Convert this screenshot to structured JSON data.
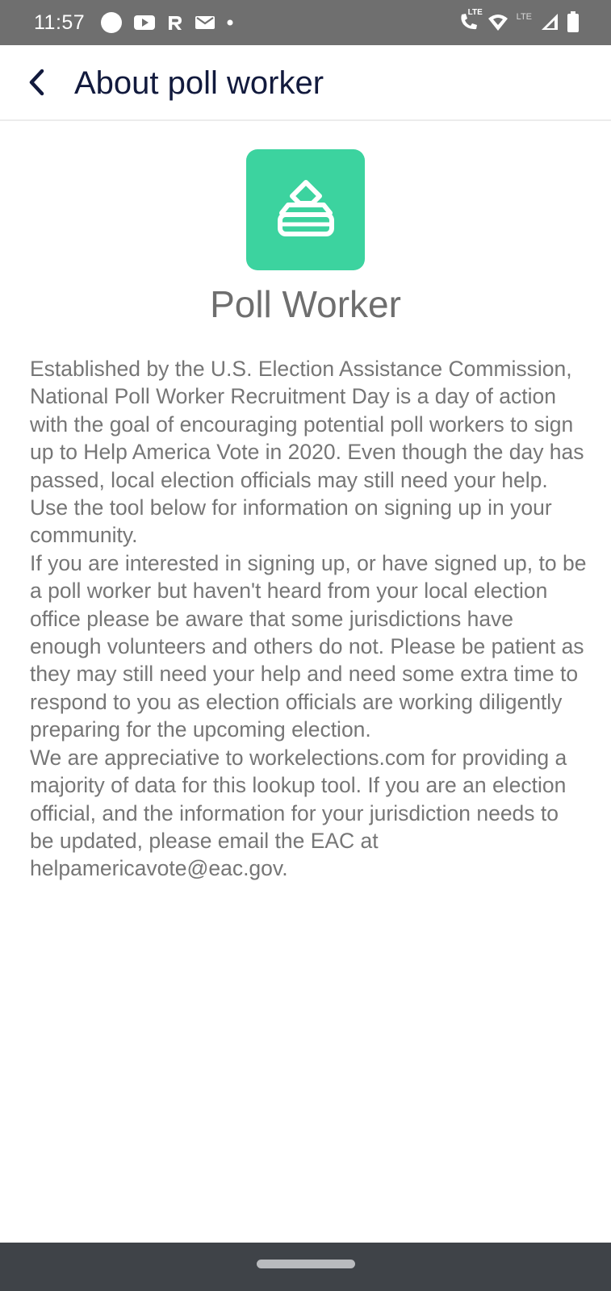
{
  "status_bar": {
    "time": "11:57",
    "left_icons": [
      "circle-icon",
      "youtube-icon",
      "r-app-icon",
      "mail-icon",
      "dot-icon"
    ],
    "right_icons": [
      "lte-call-icon",
      "wifi-icon",
      "signal-icon",
      "battery-icon"
    ],
    "lte_label": "LTE",
    "call_lte_label": "LTE"
  },
  "app_bar": {
    "back_icon": "chevron-left-icon",
    "title": "About poll worker"
  },
  "logo": {
    "icon": "ballot-box-icon",
    "color": "#3cd39f"
  },
  "content": {
    "heading": "Poll Worker",
    "paragraphs": [
      "Established by the U.S. Election Assistance Commission, National Poll Worker Recruitment Day is a day of action with the goal of encouraging potential poll workers to sign up to Help America Vote in 2020. Even though the day has passed, local election officials may still need your help. Use the tool below for information on signing up in your community.",
      "If you are interested in signing up, or have signed up, to be a poll worker but haven't heard from your local election office please be aware that some jurisdictions have enough volunteers and others do not. Please be patient as they may still need your help and need some extra time to respond to you as election officials are working diligently preparing for the upcoming election.",
      "We are appreciative to workelections.com for providing a majority of data for this lookup tool. If you are an election official, and the information for your jurisdiction needs to be updated, please email the EAC at helpamericavote@eac.gov."
    ]
  },
  "nav_bar": {
    "home_indicator": "home-pill"
  },
  "colors": {
    "status_bar_bg": "#6f6f6f",
    "title_color": "#121a3d",
    "accent": "#3cd39f",
    "body_text": "#767676",
    "nav_bar_bg": "#3f4348"
  }
}
